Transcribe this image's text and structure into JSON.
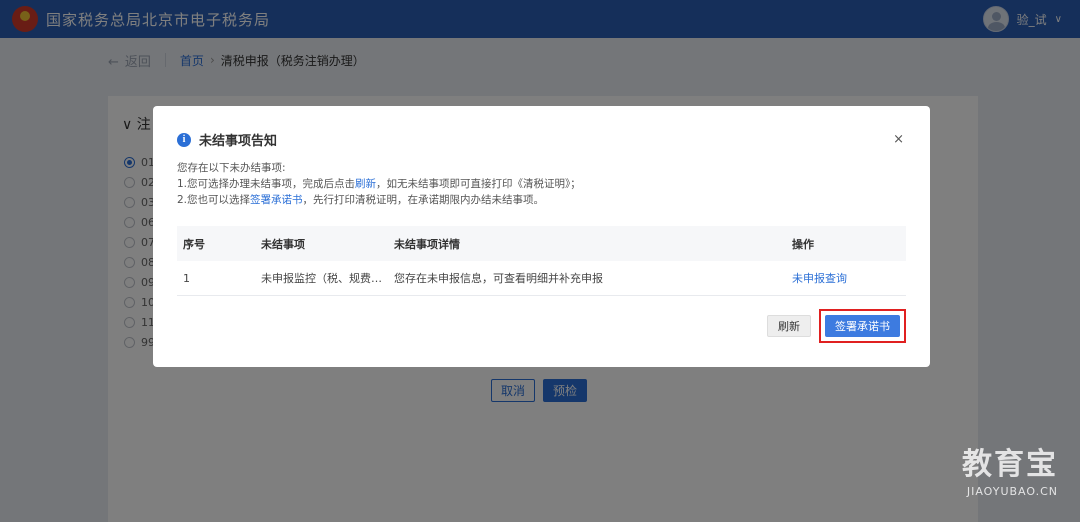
{
  "header": {
    "title": "国家税务总局北京市电子税务局",
    "username": "验_试",
    "caret": "∨"
  },
  "breadcrumb": {
    "back_arrow": "←",
    "back_label": "返回",
    "home": "首页",
    "separator": "›",
    "current": "清税申报（税务注销办理）"
  },
  "page": {
    "section_title": "∨ 注",
    "radio_items": [
      "01",
      "02",
      "03",
      "06",
      "07",
      "08",
      "09",
      "10",
      "11",
      "99"
    ],
    "cancel_label": "取消",
    "precheck_label": "预检"
  },
  "modal": {
    "info_glyph": "i",
    "title": "未结事项告知",
    "close": "×",
    "line1": "您存在以下未办结事项:",
    "line2_a": "1.您可选择办理未结事项，完成后点击",
    "line2_link": "刷新",
    "line2_b": "，如无未结事项即可直接打印《清税证明》；",
    "line3_a": "2.您也可以选择",
    "line3_link": "签署承诺书",
    "line3_b": "，先行打印清税证明，在承诺期限内办结未结事项。",
    "table": {
      "headers": [
        "序号",
        "未结事项",
        "未结事项详情",
        "操作"
      ],
      "rows": [
        [
          "1",
          "未申报监控（税、规费…",
          "您存在未申报信息，可查看明细并补充申报",
          "未申报查询"
        ]
      ]
    },
    "refresh_label": "刷新",
    "sign_label": "签署承诺书"
  },
  "watermark": {
    "main": "教育宝",
    "sub": "JIAOYUBAO.CN"
  },
  "colors": {
    "header_blue": "#2b5fb4",
    "accent": "#2b6fd6",
    "highlight_red": "#e02020"
  }
}
